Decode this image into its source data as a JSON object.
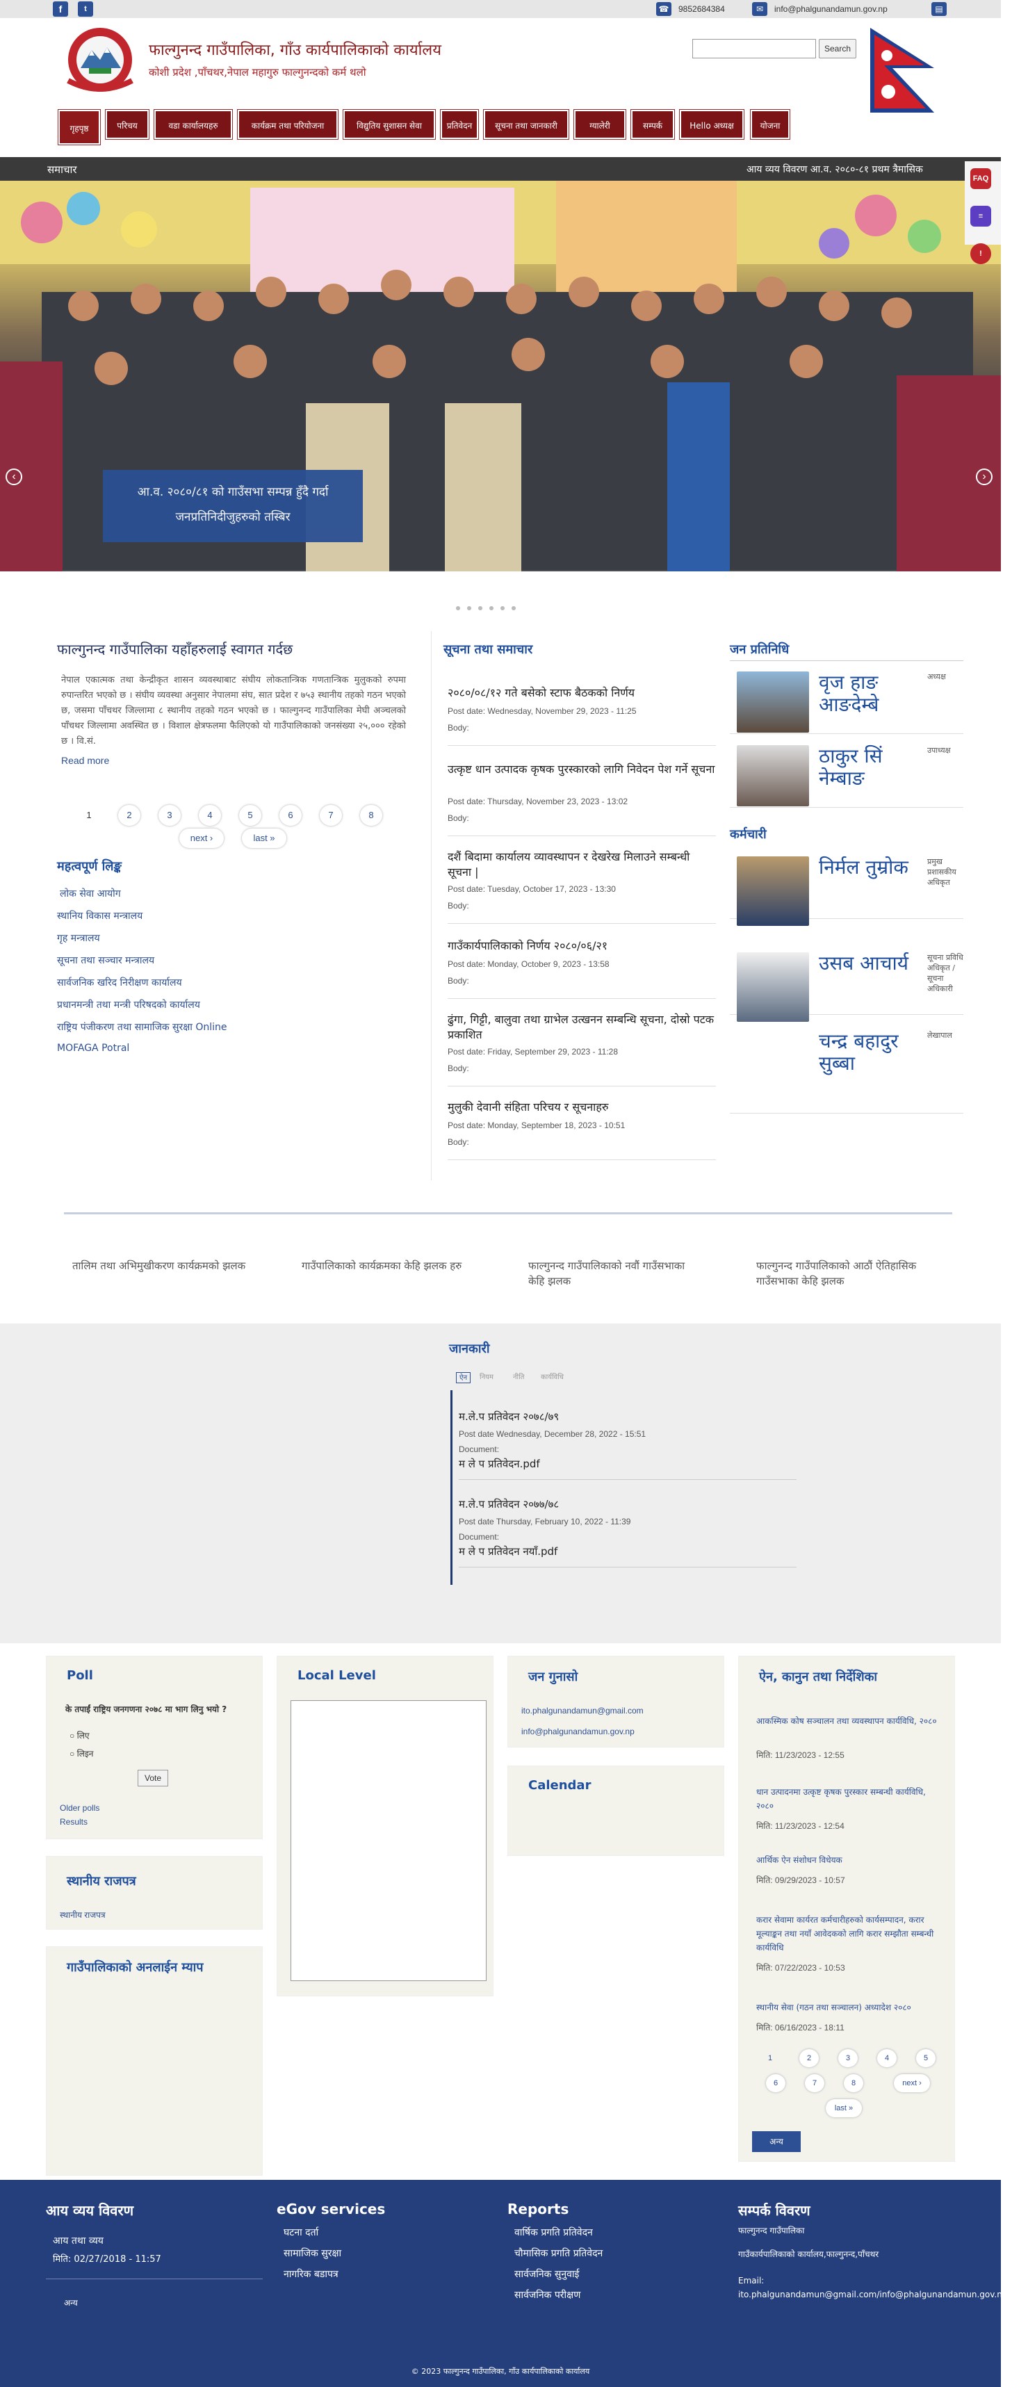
{
  "topbar": {
    "phone": "9852684384",
    "email": "info@phalgunandamun.gov.np"
  },
  "header": {
    "title": "फाल्गुनन्द गाउँपालिका, गाँउ कार्यपालिकाको कार्यालय",
    "subtitle": "कोशी प्रदेश ,पाँचथर,नेपाल महागुरु फाल्गुनन्दको कर्म थलो",
    "search_button": "Search"
  },
  "nav": [
    "गृहपृष्ठ",
    "परिचय",
    "वडा कार्यालयहरु",
    "कार्यक्रम तथा परियोजना",
    "विद्युतिय सुशासन सेवा",
    "प्रतिवेदन",
    "सूचना तथा जानकारी",
    "ग्यालेरी",
    "सम्पर्क",
    "Hello अध्यक्ष",
    "योजना"
  ],
  "ticker": {
    "label": "समाचार",
    "text": "आय व्यय विवरण आ.व. २०८०-८१ प्रथम त्रैमासिक"
  },
  "slider": {
    "caption_line1": "आ.व. २०८०/८१ को गाउँसभा सम्पन्न हुँदै गर्दा",
    "caption_line2": "जनप्रतिनिदीजुहरुको तस्बिर"
  },
  "side_icons": [
    "FAQ",
    "≡",
    "!"
  ],
  "welcome": {
    "title": "फाल्गुनन्द गाउँपालिका यहाँहरुलाई स्वागत गर्दछ",
    "body": "नेपाल एकात्मक तथा केन्द्रीकृत शासन व्यवस्थाबाट संघीय लोकतान्त्रिक गणतान्त्रिक मुलुकको रुपमा रुपान्तरित भएको छ । संघीय व्यवस्था अनुसार नेपालमा संघ, सात प्रदेश र ७५३ स्थानीय तहको गठन भएको छ, जसमा पाँचथर जिल्लामा ८ स्थानीय तहको गठन भएको छ । फाल्गुनन्द गाउँपालिका मेघी अञ्चलको पाँचथर जिल्लामा अवस्थित छ । विशाल क्षेत्रफलमा फैलिएको यो गाउँपालिकाको जनसंख्या २५,००० रहेको छ । वि.सं.",
    "read_more": "Read more"
  },
  "pager": {
    "pages": [
      "1",
      "2",
      "3",
      "4",
      "5",
      "6",
      "7",
      "8"
    ],
    "next": "next ›",
    "last": "last »"
  },
  "important_links": {
    "title": "महत्वपूर्ण लिङ्क",
    "items": [
      "लोक सेवा आयोग",
      "स्थानिय विकास मन्त्रालय",
      "गृह मन्त्रालय",
      "सूचना तथा सञ्चार मन्त्रालय",
      "सार्वजनिक खरिद निरीक्षण कार्यालय",
      "प्रधानमन्त्री तथा मन्त्री परिषदको कार्यालय",
      "राष्ट्रिय पंजीकरण तथा सामाजिक सुरक्षा Online",
      "MOFAGA Potral"
    ]
  },
  "news": {
    "title": "सूचना तथा समाचार",
    "items": [
      {
        "title": "२०८०/०८/१२ गते बसेको स्टाफ बैठकको निर्णय",
        "date": "Post date: Wednesday, November 29, 2023 - 11:25",
        "body": "Body:"
      },
      {
        "title": "उत्कृष्ट धान उत्पादक कृषक पुरस्कारको लागि निवेदन पेश गर्ने सूचना",
        "date": "Post date: Thursday, November 23, 2023 - 13:02",
        "body": "Body:"
      },
      {
        "title": "दशैं बिदामा कार्यालय व्यावस्थापन र देखरेख मिलाउने सम्बन्धी सूचना |",
        "date": "Post date: Tuesday, October 17, 2023 - 13:30",
        "body": "Body:"
      },
      {
        "title": "गाउँकार्यपालिकाको निर्णय २०८०/०६/२१",
        "date": "Post date: Monday, October 9, 2023 - 13:58",
        "body": "Body:"
      },
      {
        "title": "ढुंगा, गिट्टी, बालुवा तथा ग्राभेल उत्खनन सम्बन्धि सूचना, दोस्रो पटक प्रकाशित",
        "date": "Post date: Friday, September 29, 2023 - 11:28",
        "body": "Body:"
      },
      {
        "title": "मुलुकी देवानी संहिता परिचय र सूचनाहरु",
        "date": "Post date: Monday, September 18, 2023 - 10:51",
        "body": "Body:"
      }
    ]
  },
  "representatives": {
    "title": "जन प्रतिनिधि",
    "items": [
      {
        "name": "वृज हाङ आङदेम्बे",
        "role": "अध्यक्ष"
      },
      {
        "name": "ठाकुर सिं नेम्बाङ",
        "role": "उपाध्यक्ष"
      }
    ]
  },
  "staff": {
    "title": "कर्मचारी",
    "items": [
      {
        "name": "निर्मल तुम्रोक",
        "role": "प्रमुख प्रशासकीय अधिकृत"
      },
      {
        "name": "उसब आचार्य",
        "role": "सूचना प्रविधि अधिकृत / सूचना अधिकारी"
      },
      {
        "name": "चन्द्र बहादुर सुब्बा",
        "role": "लेखापाल"
      }
    ]
  },
  "gallery": [
    "तालिम तथा अभिमुखीकरण कार्यक्रमको झलक",
    "गाउँपालिकाको कार्यक्रमका केहि झलक हरु",
    "फाल्गुनन्द गाउँपालिकाको नवौं गाउँसभाका केहि झलक",
    "फाल्गुनन्द गाउँपालिकाको आठौं ऐतिहासिक गाउँसभाका केहि झलक"
  ],
  "info": {
    "title": "जानकारी",
    "tabs": [
      "ऐन",
      "नियम",
      "नीति",
      "कार्यविधि"
    ],
    "docs": [
      {
        "title": "म.ले.प प्रतिवेदन २०७८/७९",
        "date": "Post date Wednesday, December 28, 2022 - 15:51",
        "label": "Document:",
        "file": "म ले प प्रतिवेदन.pdf"
      },
      {
        "title": "म.ले.प प्रतिवेदन २०७७/७८",
        "date": "Post date Thursday, February 10, 2022 - 11:39",
        "label": "Document:",
        "file": "म ले प प्रतिवेदन नयाँ.pdf"
      }
    ]
  },
  "poll": {
    "title": "Poll",
    "question": "के तपाईं राष्ट्रिय जनगणना २०७८ मा भाग लिनु भयो ?",
    "options": [
      "लिए",
      "लिइन"
    ],
    "vote": "Vote",
    "older": "Older polls",
    "results": "Results"
  },
  "gazette": {
    "title": "स्थानीय राजपत्र",
    "link": "स्थानीय राजपत्र"
  },
  "map": {
    "title": "गाउँपालिकाको अनलाईन म्याप"
  },
  "local_level": {
    "title": "Local Level"
  },
  "complaint": {
    "title": "जन गुनासो",
    "email1": "ito.phalgunandamun@gmail.com",
    "email2": "info@phalgunandamun.gov.np"
  },
  "calendar": {
    "title": "Calendar"
  },
  "laws": {
    "title": "ऐन, कानुन तथा निर्देशिका",
    "items": [
      {
        "title": "आकस्मिक कोष सञ्चालन तथा व्यवस्थापन कार्यविधि, २०८०",
        "date": "मिति: 11/23/2023 - 12:55"
      },
      {
        "title": "धान उत्पादनमा उत्कृष्ट कृषक पुरस्कार सम्बन्धी कार्यविधि, २०८०",
        "date": "मिति: 11/23/2023 - 12:54"
      },
      {
        "title": "आर्थिक ऐन संशोधन विधेयक",
        "date": "मिति: 09/29/2023 - 10:57"
      },
      {
        "title": "करार सेवामा कार्यरत कर्मचारीहरुको कार्यसम्पादन, करार मूल्याङ्कन तथा नयाँ आवेदकको लागि करार सम्झौता सम्बन्धी कार्यविधि",
        "date": "मिति: 07/22/2023 - 10:53"
      },
      {
        "title": "स्थानीय सेवा (गठन तथा सञ्चालन) अध्यादेश २०८०",
        "date": "मिति: 06/16/2023 - 18:11"
      }
    ],
    "pages": [
      "1",
      "2",
      "3",
      "4",
      "5",
      "6",
      "7",
      "8"
    ],
    "next": "next ›",
    "last": "last »",
    "more": "अन्य"
  },
  "footer": {
    "col1": {
      "title": "आय व्यय विवरण",
      "item": "आय तथा व्यय",
      "date": "मिति: 02/27/2018 - 11:57",
      "more": "अन्य"
    },
    "col2": {
      "title": "eGov services",
      "items": [
        "घटना दर्ता",
        "सामाजिक सुरक्षा",
        "नागरिक बडापत्र"
      ]
    },
    "col3": {
      "title": "Reports",
      "items": [
        "वार्षिक प्रगति प्रतिवेदन",
        "चौमासिक प्रगति प्रतिवेदन",
        "सार्वजनिक सुनुवाई",
        "सार्वजनिक परीक्षण"
      ]
    },
    "col4": {
      "title": "सम्पर्क विवरण",
      "line1": "फाल्गुनन्द गाउँपालिका",
      "line2": "गाउँकार्यपालिकाको कार्यालय,फाल्गुनन्द,पाँचथर",
      "email_label": "Email:",
      "email": "ito.phalgunandamun@gmail.com/info@phalgunandamun.gov.np"
    },
    "copyright": "© 2023 फाल्गुनन्द गाउँपालिका, गाँउ कार्यपालिकाको कार्यालय"
  }
}
